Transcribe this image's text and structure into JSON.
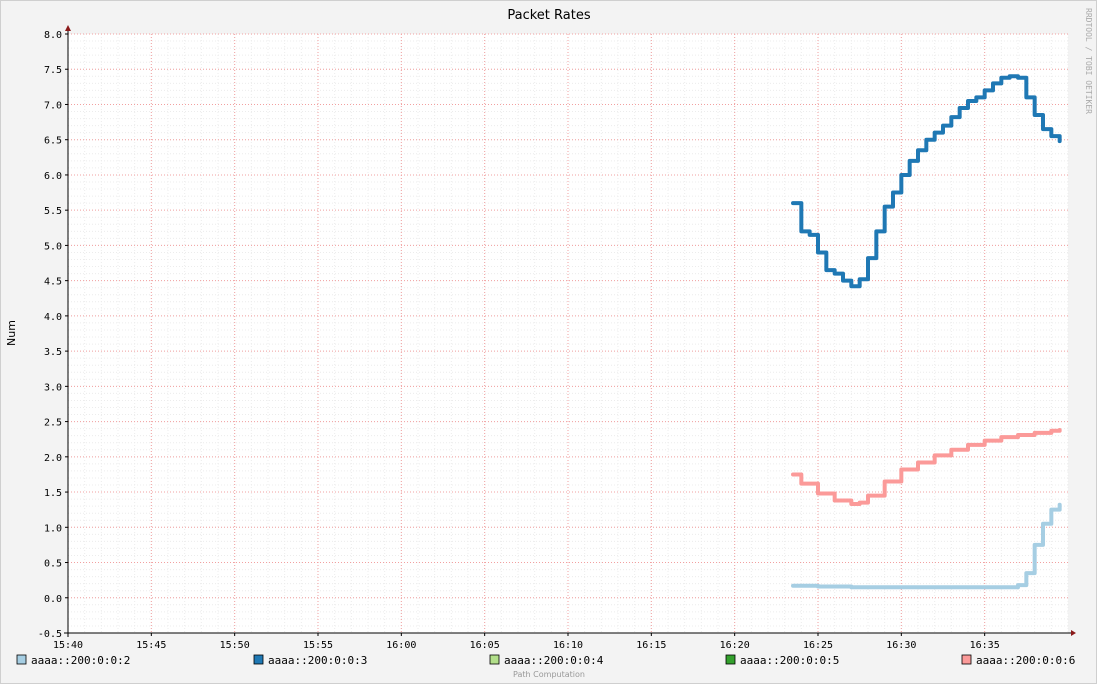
{
  "chart_data": {
    "type": "line",
    "title": "Packet Rates",
    "ylabel": "Num",
    "xlabel": "",
    "watermark": "RRDTOOL / TOBI OETIKER",
    "footer": "Path Computation",
    "x_unit": "time (hh:mm)",
    "xlim": [
      "15:40",
      "16:40"
    ],
    "ylim": [
      -0.5,
      8.0
    ],
    "x_ticks": [
      "15:40",
      "15:45",
      "15:50",
      "15:55",
      "16:00",
      "16:05",
      "16:10",
      "16:15",
      "16:20",
      "16:25",
      "16:30",
      "16:35"
    ],
    "y_ticks": [
      "-0.5",
      "0.0",
      "0.5",
      "1.0",
      "1.5",
      "2.0",
      "2.5",
      "3.0",
      "3.5",
      "4.0",
      "4.5",
      "5.0",
      "5.5",
      "6.0",
      "6.5",
      "7.0",
      "7.5",
      "8.0"
    ],
    "grid": true,
    "legend_position": "bottom",
    "series": [
      {
        "name": "aaaa::200:0:0:2",
        "color": "#a6cee3",
        "x": [
          "16:23:30",
          "16:25:00",
          "16:27:00",
          "16:30:00",
          "16:33:00",
          "16:35:00",
          "16:36:00",
          "16:37:00",
          "16:37:30",
          "16:38:00",
          "16:38:30",
          "16:39:00",
          "16:39:30"
        ],
        "values": [
          0.17,
          0.16,
          0.15,
          0.15,
          0.15,
          0.15,
          0.15,
          0.18,
          0.35,
          0.75,
          1.05,
          1.25,
          1.32
        ]
      },
      {
        "name": "aaaa::200:0:0:3",
        "color": "#1f78b4",
        "x": [
          "16:23:30",
          "16:24:00",
          "16:24:30",
          "16:25:00",
          "16:25:30",
          "16:26:00",
          "16:26:30",
          "16:27:00",
          "16:27:30",
          "16:28:00",
          "16:28:30",
          "16:29:00",
          "16:29:30",
          "16:30:00",
          "16:30:30",
          "16:31:00",
          "16:31:30",
          "16:32:00",
          "16:32:30",
          "16:33:00",
          "16:33:30",
          "16:34:00",
          "16:34:30",
          "16:35:00",
          "16:35:30",
          "16:36:00",
          "16:36:30",
          "16:37:00",
          "16:37:30",
          "16:38:00",
          "16:38:30",
          "16:39:00",
          "16:39:30"
        ],
        "values": [
          5.6,
          5.2,
          5.15,
          4.9,
          4.65,
          4.6,
          4.5,
          4.42,
          4.52,
          4.82,
          5.2,
          5.55,
          5.75,
          6.0,
          6.2,
          6.35,
          6.5,
          6.6,
          6.7,
          6.82,
          6.95,
          7.05,
          7.1,
          7.2,
          7.3,
          7.38,
          7.4,
          7.38,
          7.1,
          6.85,
          6.65,
          6.55,
          6.48
        ]
      },
      {
        "name": "aaaa::200:0:0:4",
        "color": "#b2df8a",
        "x": [],
        "values": []
      },
      {
        "name": "aaaa::200:0:0:5",
        "color": "#33a02c",
        "x": [],
        "values": []
      },
      {
        "name": "aaaa::200:0:0:6",
        "color": "#fb9a99",
        "x": [
          "16:23:30",
          "16:24:00",
          "16:25:00",
          "16:26:00",
          "16:27:00",
          "16:27:30",
          "16:28:00",
          "16:29:00",
          "16:30:00",
          "16:31:00",
          "16:32:00",
          "16:33:00",
          "16:34:00",
          "16:35:00",
          "16:36:00",
          "16:37:00",
          "16:38:00",
          "16:39:00",
          "16:39:30"
        ],
        "values": [
          1.75,
          1.62,
          1.48,
          1.38,
          1.33,
          1.35,
          1.45,
          1.65,
          1.82,
          1.92,
          2.02,
          2.1,
          2.17,
          2.23,
          2.28,
          2.31,
          2.34,
          2.37,
          2.38
        ]
      }
    ]
  }
}
